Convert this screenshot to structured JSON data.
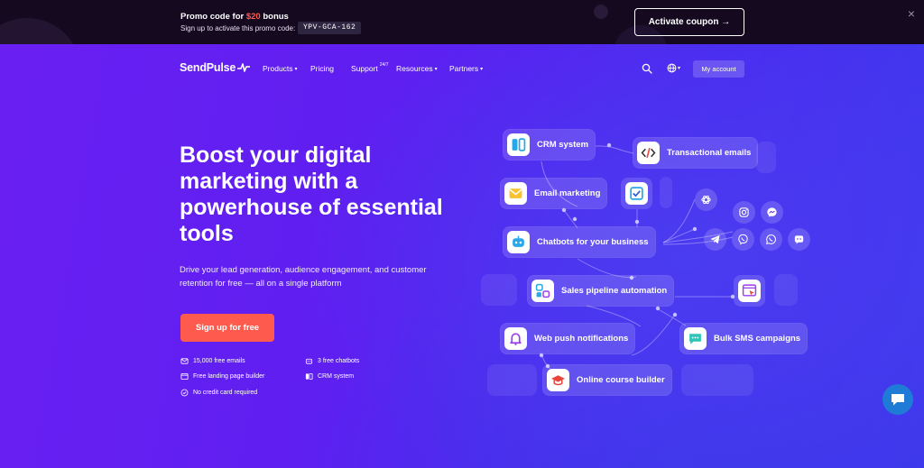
{
  "promo": {
    "title_prefix": "Promo code for ",
    "title_amount": "$20",
    "title_suffix": " bonus",
    "subtitle": "Sign up to activate this promo code:",
    "code": "YPV-GCA-162",
    "activate_label": "Activate coupon →",
    "close_icon": "×"
  },
  "nav": {
    "logo": "SendPulse",
    "items": [
      {
        "label": "Products",
        "chevron": "▾"
      },
      {
        "label": "Pricing"
      },
      {
        "label": "Support",
        "sup": "24/7"
      },
      {
        "label": "Resources",
        "chevron": "▾"
      },
      {
        "label": "Partners",
        "chevron": "▾"
      }
    ],
    "globe_chevron": "▾",
    "my_account": "My account"
  },
  "hero": {
    "headline": "Boost your digital marketing with a powerhouse of essential tools",
    "subline": "Drive your lead generation, audience engagement, and customer retention for free — all on a single platform",
    "cta": "Sign up for free",
    "features": [
      {
        "label": "15,000 free emails",
        "icon": "mail-icon"
      },
      {
        "label": "3 free chatbots",
        "icon": "bot-icon"
      },
      {
        "label": "Free landing page builder",
        "icon": "browser-icon"
      },
      {
        "label": "CRM system",
        "icon": "crm-icon"
      },
      {
        "label": "No credit card required",
        "icon": "check-circle-icon"
      }
    ]
  },
  "diagram": {
    "cards": [
      {
        "label": "CRM system",
        "icon": "crm-icon"
      },
      {
        "label": "Transactional emails",
        "icon": "code-icon"
      },
      {
        "label": "Email marketing",
        "icon": "envelope-icon"
      },
      {
        "label": "Chatbots for your business",
        "icon": "bot-icon"
      },
      {
        "label": "Sales pipeline automation",
        "icon": "pipeline-icon"
      },
      {
        "label": "Web push notifications",
        "icon": "bell-icon"
      },
      {
        "label": "Bulk SMS campaigns",
        "icon": "sms-icon"
      },
      {
        "label": "Online course builder",
        "icon": "graduation-cap-icon"
      }
    ],
    "messengers": [
      "openai",
      "instagram",
      "messenger",
      "telegram",
      "viber",
      "whatsapp",
      "chat"
    ]
  },
  "colors": {
    "accent": "#ff5a4e",
    "hero_bg": "#5a1ef0",
    "promo_bg": "#14091f",
    "chat_widget": "#1e7bd6"
  }
}
